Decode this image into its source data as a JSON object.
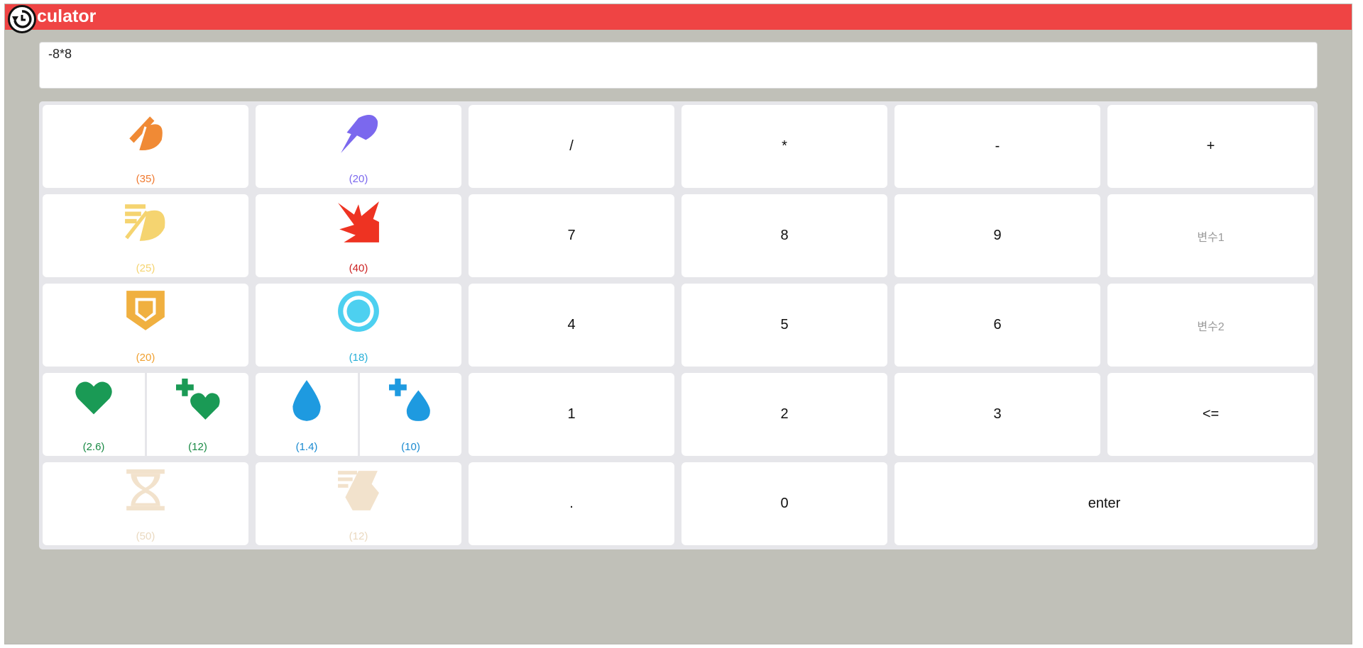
{
  "app": {
    "title": "culator"
  },
  "display": {
    "expression": "-8*8"
  },
  "skills": {
    "attack": {
      "count": "(35)",
      "color": "#f08a35"
    },
    "dash": {
      "count": "(20)",
      "color": "#7b68ee"
    },
    "haste": {
      "count": "(25)",
      "color": "#f5d470"
    },
    "burst": {
      "count": "(40)",
      "color": "#ee3322"
    },
    "shield": {
      "count": "(20)",
      "color": "#f0b040"
    },
    "barrier": {
      "count": "(18)",
      "color": "#4dd0f0"
    },
    "hp": {
      "count": "(2.6)",
      "color": "#1a9a55"
    },
    "hp_plus": {
      "count": "(12)",
      "color": "#1a9a55"
    },
    "mp": {
      "count": "(1.4)",
      "color": "#1e9ae0"
    },
    "mp_plus": {
      "count": "(10)",
      "color": "#1e9ae0"
    },
    "hourglass": {
      "count": "(50)",
      "color": "#f2e2cc"
    },
    "boot": {
      "count": "(12)",
      "color": "#f2e2cc"
    }
  },
  "keys": {
    "divide": "/",
    "multiply": "*",
    "minus": "-",
    "plus": "+",
    "seven": "7",
    "eight": "8",
    "nine": "9",
    "var1": "변수1",
    "four": "4",
    "five": "5",
    "six": "6",
    "var2": "변수2",
    "one": "1",
    "two": "2",
    "three": "3",
    "backspace": "<=",
    "dot": ".",
    "zero": "0",
    "enter": "enter"
  },
  "count_colors": {
    "attack": "#f07a30",
    "dash": "#7b68ee",
    "haste": "#f5d470",
    "burst": "#cc2222",
    "shield": "#f0a030",
    "barrier": "#28b0d8",
    "hp": "#1a8a45",
    "mp": "#1a8ad0",
    "faded": "#ead9c0"
  }
}
